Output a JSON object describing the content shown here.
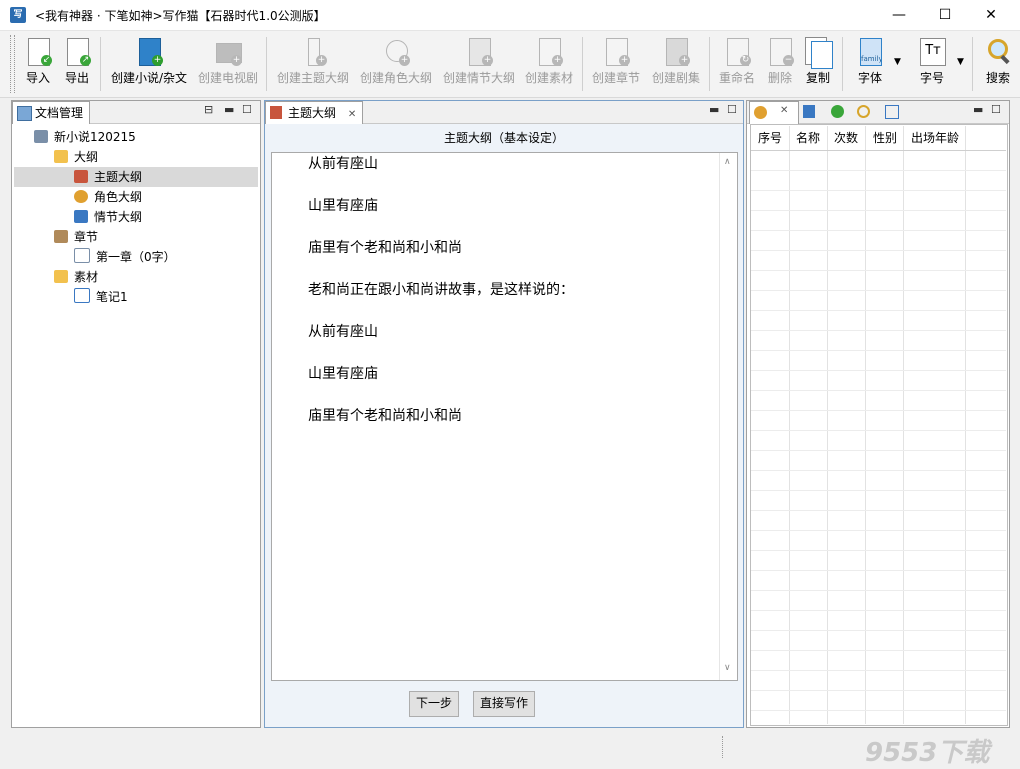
{
  "window": {
    "title": "<我有神器 · 下笔如神>写作猫【石器时代1.0公测版】",
    "app_icon_glyph": "写",
    "controls": {
      "minimize": "—",
      "maximize": "☐",
      "close": "✕"
    }
  },
  "toolbar": {
    "import": "导入",
    "export": "导出",
    "create_novel": "创建小说/杂文",
    "create_tv": "创建电视剧",
    "create_theme_outline": "创建主题大纲",
    "create_role_outline": "创建角色大纲",
    "create_plot_outline": "创建情节大纲",
    "create_material": "创建素材",
    "create_chapter": "创建章节",
    "create_episode": "创建剧集",
    "rename": "重命名",
    "delete": "删除",
    "copy": "复制",
    "font": "字体",
    "font_size": "字号",
    "search": "搜索",
    "font_icon_text": "family",
    "size_icon_text": "Tт"
  },
  "doc_panel": {
    "tab_label": "文档管理",
    "tree": {
      "root": "新小说120215",
      "outline": "大纲",
      "theme_outline": "主题大纲",
      "role_outline": "角色大纲",
      "plot_outline": "情节大纲",
      "chapters": "章节",
      "chapter1": "第一章（0字）",
      "materials": "素材",
      "note1": "笔记1"
    }
  },
  "editor_panel": {
    "tab_label": "主题大纲",
    "tab_close": "✕",
    "header": "主题大纲（基本设定）",
    "lines": [
      "从前有座山",
      "山里有座庙",
      "庙里有个老和尚和小和尚",
      "老和尚正在跟小和尚讲故事，是这样说的：",
      "从前有座山",
      "山里有座庙",
      "庙里有个老和尚和小和尚"
    ],
    "next_button": "下一步",
    "write_button": "直接写作"
  },
  "right_panel": {
    "columns": [
      "序号",
      "名称",
      "次数",
      "性别",
      "出场年龄"
    ]
  },
  "watermark": "9553下载"
}
